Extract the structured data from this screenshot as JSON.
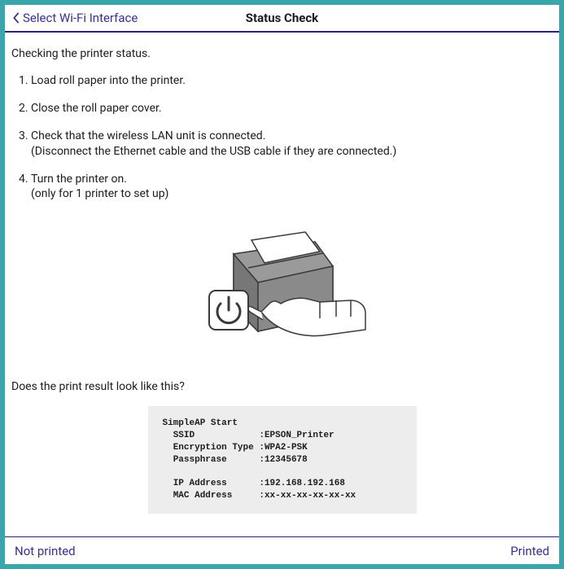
{
  "nav": {
    "back_label": "Select Wi-Fi Interface",
    "title": "Status Check"
  },
  "intro": "Checking the printer status.",
  "steps": [
    {
      "text": "Load roll paper into the printer."
    },
    {
      "text": "Close the roll paper cover."
    },
    {
      "text": "Check that the wireless LAN unit is connected.",
      "sub": "(Disconnect the Ethernet cable and the USB cable if they are connected.)"
    },
    {
      "text": "Turn the printer on.",
      "sub": "(only for 1 printer to set up)"
    }
  ],
  "question": "Does the print result look like this?",
  "printout": {
    "header": "SimpleAP Start",
    "rows": [
      {
        "label": "SSID",
        "value": "EPSON_Printer"
      },
      {
        "label": "Encryption Type",
        "value": "WPA2-PSK"
      },
      {
        "label": "Passphrase",
        "value": "12345678"
      }
    ],
    "rows2": [
      {
        "label": "IP Address",
        "value": "192.168.192.168"
      },
      {
        "label": "MAC Address",
        "value": "xx-xx-xx-xx-xx-xx"
      }
    ]
  },
  "footer": {
    "left": "Not printed",
    "right": "Printed"
  },
  "icons": {
    "back": "chevron-left",
    "power": "power"
  }
}
